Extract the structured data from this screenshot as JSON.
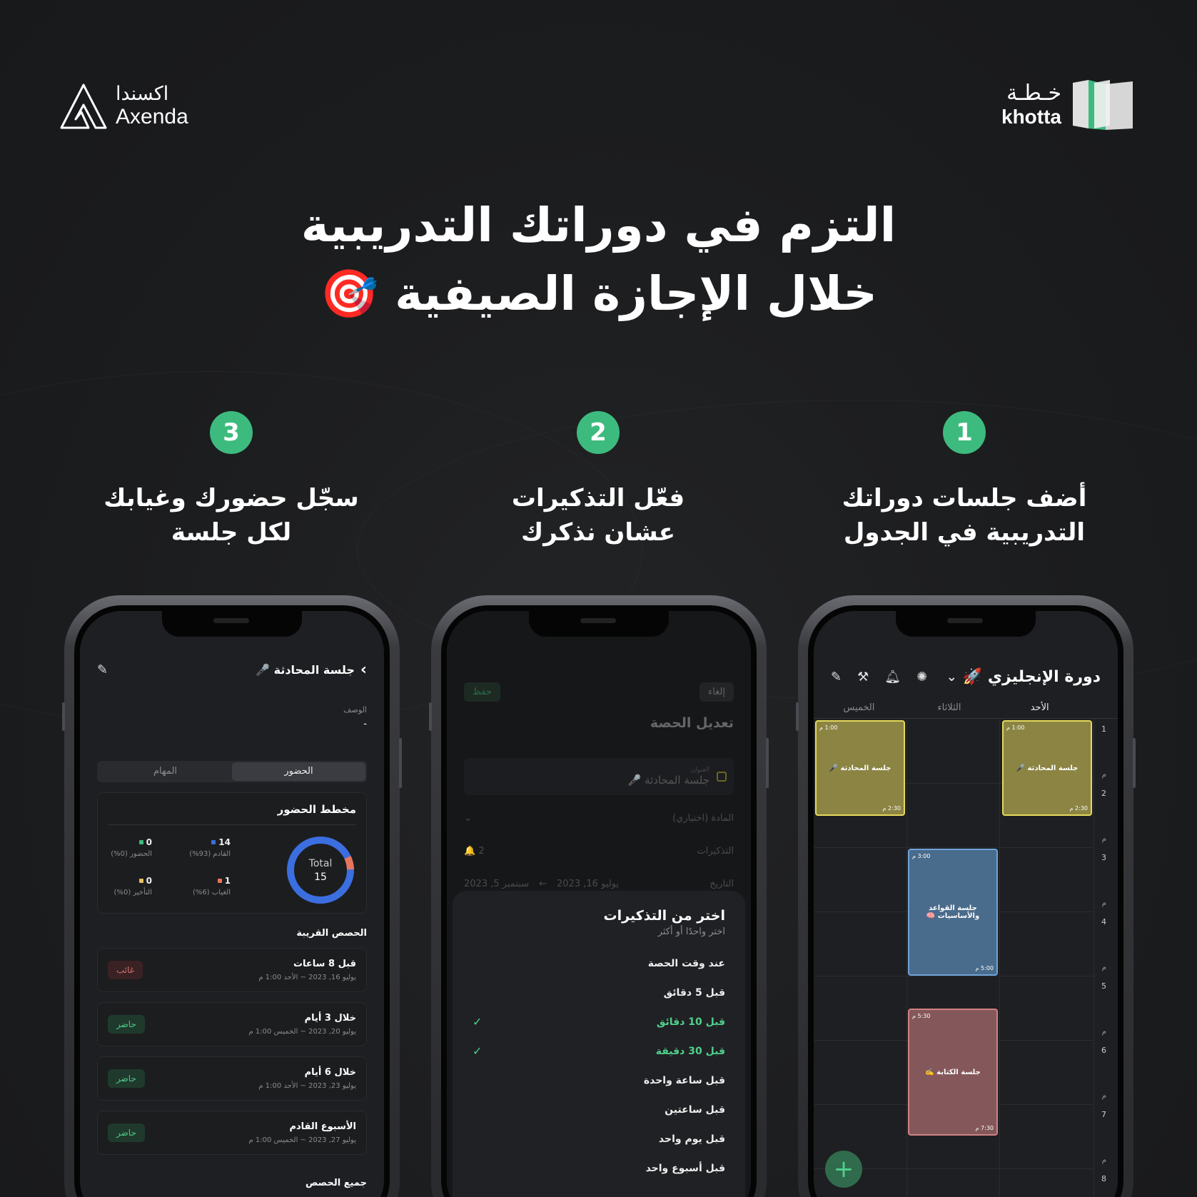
{
  "brand": {
    "axenda_ar": "اكسندا",
    "axenda_en": "Axenda",
    "khotta_ar": "خـطـة",
    "khotta_en": "khotta"
  },
  "headline": {
    "line1": "التزم في دوراتك التدريبية",
    "line2": "خلال الإجازة الصيفية 🎯"
  },
  "steps": [
    {
      "num": "1",
      "line1": "أضف جلسات دوراتك",
      "line2": "التدريبية في الجدول"
    },
    {
      "num": "2",
      "line1": "فعّل التذكيرات",
      "line2": "عشان نذكرك"
    },
    {
      "num": "3",
      "line1": "سجّل حضورك وغيابك",
      "line2": "لكل جلسة"
    }
  ],
  "calendar": {
    "title": "دورة الإنجليزي 🚀",
    "days": [
      "الأحد",
      "الثلاثاء",
      "الخميس"
    ],
    "hours": [
      "1",
      "2",
      "3",
      "4",
      "5",
      "6",
      "7",
      "8"
    ],
    "pm": "م",
    "events": {
      "conv_sun": {
        "title": "جلسة المحادثة 🎤",
        "start": "1:00 م",
        "end": "2:30 م"
      },
      "conv_thu": {
        "title": "جلسة المحادثة 🎤",
        "start": "1:00 م",
        "end": "2:30 م"
      },
      "grammar": {
        "title": "جلسة القواعد والأساسيات 🧠",
        "start": "3:00 م",
        "end": "5:00 م"
      },
      "writing": {
        "title": "جلسة الكتابة ✍️",
        "start": "5:30 م",
        "end": "7:30 م"
      }
    },
    "colors": {
      "yellow": "#e5d95b",
      "blue": "#6fa4d9",
      "red": "#d08284",
      "accent": "#3dbb7e"
    }
  },
  "edit": {
    "cancel": "إلغاء",
    "save": "حفظ",
    "title": "تعديل الحصة",
    "field_label": "العنوان",
    "field_value": "جلسة المحادثة 🎤",
    "subject": "المادة (اختياري)",
    "reminders": "التذكيرات",
    "reminders_count": "2 🔔",
    "date": "التاريخ",
    "date_from": "يوليو 16, 2023",
    "date_to": "سبتمبر 5, 2023",
    "sheet_title": "اختر من التذكيرات",
    "sheet_sub": "اختر واحدًا أو أكثر",
    "options": [
      {
        "label": "عند وقت الحصة",
        "on": false
      },
      {
        "label": "قبل 5 دقائق",
        "on": false
      },
      {
        "label": "قبل 10 دقائق",
        "on": true
      },
      {
        "label": "قبل 30 دقيقة",
        "on": true
      },
      {
        "label": "قبل ساعة واحدة",
        "on": false
      },
      {
        "label": "قبل ساعتين",
        "on": false
      },
      {
        "label": "قبل يوم واحد",
        "on": false
      },
      {
        "label": "قبل أسبوع واحد",
        "on": false
      }
    ]
  },
  "attendance": {
    "title": "جلسة المحادثة 🎤",
    "desc_label": "الوصف",
    "desc_value": "-",
    "tab_attendance": "الحضور",
    "tab_tasks": "المهام",
    "chart_title": "مخطط الحضور",
    "total_label": "Total",
    "total_value": "15",
    "stats": {
      "upcoming": {
        "value": "14",
        "label": "القادم (93%)",
        "color": "#3b6fe0"
      },
      "present": {
        "value": "0",
        "label": "الحضور (0%)",
        "color": "#3dbb7e"
      },
      "absent": {
        "value": "1",
        "label": "الغياب (6%)",
        "color": "#e8765a"
      },
      "late": {
        "value": "0",
        "label": "التأخير (0%)",
        "color": "#e8c05a"
      }
    },
    "near_title": "الحصص القريبة",
    "sessions": [
      {
        "title": "قبل 8 ساعات",
        "date": "يوليو 16, 2023 ~ الأحد 1:00 م",
        "status": "غائب",
        "kind": "abs"
      },
      {
        "title": "خلال 3 أيام",
        "date": "يوليو 20, 2023 ~ الخميس 1:00 م",
        "status": "حاضر",
        "kind": "pre"
      },
      {
        "title": "خلال 6 أيام",
        "date": "يوليو 23, 2023 ~ الأحد 1:00 م",
        "status": "حاضر",
        "kind": "pre"
      },
      {
        "title": "الأسبوع القادم",
        "date": "يوليو 27, 2023 ~ الخميس 1:00 م",
        "status": "حاضر",
        "kind": "pre"
      }
    ],
    "all_title": "جميع الحصص"
  }
}
